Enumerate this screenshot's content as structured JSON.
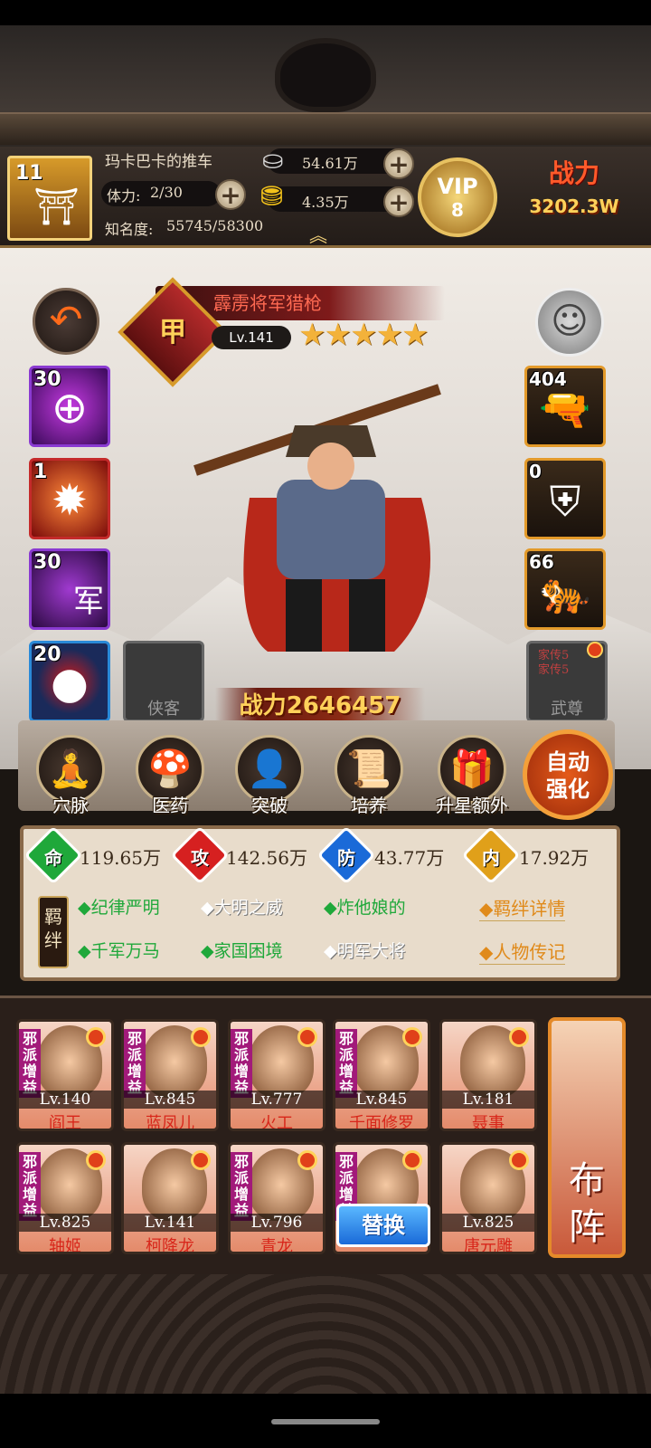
{
  "player": {
    "level": "11",
    "name": "玛卡巴卡的推车",
    "stamina_label": "体力:",
    "stamina": "2/30",
    "fame_label": "知名度:",
    "fame": "55745/58300"
  },
  "currency": {
    "silver": "54.61万",
    "gold": "4.35万"
  },
  "vip": {
    "label": "VIP",
    "level": "8"
  },
  "total_power": {
    "label": "战力",
    "value": "3202.3W"
  },
  "hero": {
    "title": "霹雳将军猎枪",
    "rank": "甲",
    "level": "Lv.141",
    "stars": 5,
    "power_label": "战力",
    "power": "2646457"
  },
  "skills": [
    {
      "value": "30",
      "icon": "crosshair-icon"
    },
    {
      "value": "1",
      "icon": "explosion-icon"
    },
    {
      "value": "30",
      "icon": "army-icon",
      "mark": "军"
    },
    {
      "value": "20",
      "icon": "red-orb-icon"
    }
  ],
  "companion_slot": {
    "label": "侠客"
  },
  "equipment": [
    {
      "value": "404",
      "icon": "gun-icon"
    },
    {
      "value": "0",
      "icon": "armor-icon"
    },
    {
      "value": "66",
      "icon": "beast-icon"
    }
  ],
  "artifact_slot": {
    "label": "武尊",
    "lines": "家传5\n家传5"
  },
  "functions": [
    {
      "label": "穴脉",
      "icon": "meridian-icon"
    },
    {
      "label": "医药",
      "icon": "medicine-icon"
    },
    {
      "label": "突破",
      "icon": "breakthrough-icon"
    },
    {
      "label": "培养",
      "icon": "training-icon"
    },
    {
      "label": "升星额外",
      "icon": "star-up-icon"
    }
  ],
  "auto_enhance": {
    "line1": "自动",
    "line2": "强化"
  },
  "stats": [
    {
      "tag": "命",
      "value": "119.65万",
      "color": "#1fa83a"
    },
    {
      "tag": "攻",
      "value": "142.56万",
      "color": "#d62020"
    },
    {
      "tag": "防",
      "value": "43.77万",
      "color": "#1a6ad8"
    },
    {
      "tag": "内",
      "value": "17.92万",
      "color": "#e0a01a"
    }
  ],
  "bond": {
    "line1": "羁",
    "line2": "绊",
    "traits": [
      {
        "text": "◆纪律严明",
        "active": true
      },
      {
        "text": "◆大明之威",
        "active": false
      },
      {
        "text": "◆炸他娘的",
        "active": true
      },
      {
        "text": "◆千军万马",
        "active": true
      },
      {
        "text": "◆家国困境",
        "active": true
      },
      {
        "text": "◆明军大将",
        "active": false
      }
    ]
  },
  "links": {
    "bond_detail": "◆羁绊详情",
    "biography": "◆人物传记"
  },
  "roster": [
    {
      "level": "Lv.140",
      "name": "阎王",
      "tag": "邪派增益"
    },
    {
      "level": "Lv.845",
      "name": "蓝凤儿",
      "tag": "邪派增益"
    },
    {
      "level": "Lv.777",
      "name": "火工",
      "tag": "邪派增益"
    },
    {
      "level": "Lv.845",
      "name": "千面修罗",
      "tag": "邪派增益"
    },
    {
      "level": "Lv.181",
      "name": "聂事",
      "tag": ""
    },
    {
      "level": "Lv.825",
      "name": "轴姬",
      "tag": "邪派增益"
    },
    {
      "level": "Lv.141",
      "name": "柯降龙",
      "tag": ""
    },
    {
      "level": "Lv.796",
      "name": "青龙",
      "tag": "邪派增益"
    },
    {
      "level": "",
      "name": "",
      "tag": "邪派增益"
    },
    {
      "level": "Lv.825",
      "name": "唐元雕",
      "tag": ""
    }
  ],
  "swap_label": "替换",
  "formation_label": "布阵"
}
